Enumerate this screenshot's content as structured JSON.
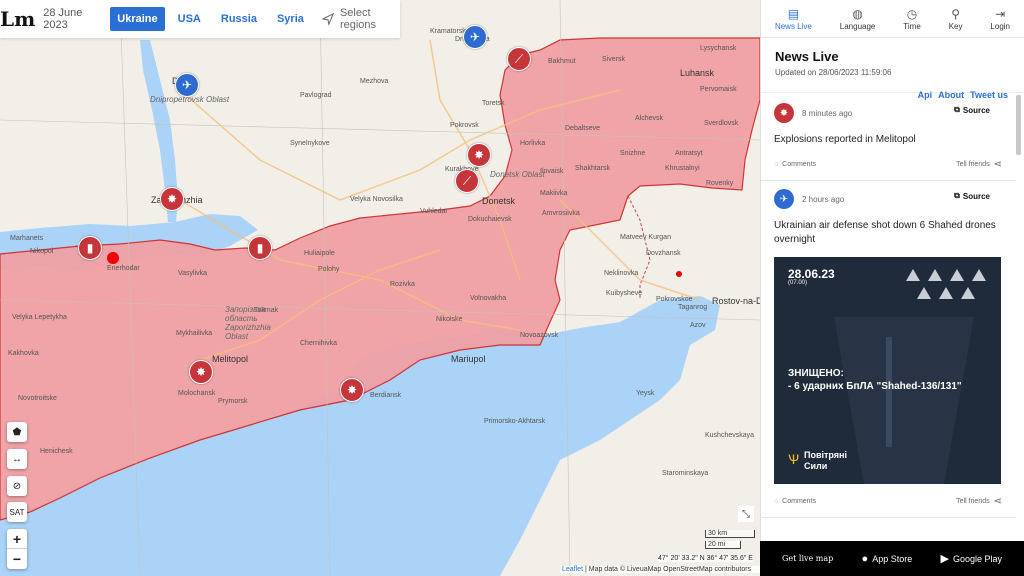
{
  "header": {
    "logo": "Lm",
    "date": "28 June 2023",
    "tabs": [
      {
        "label": "Ukraine",
        "active": true
      },
      {
        "label": "USA",
        "active": false
      },
      {
        "label": "Russia",
        "active": false
      },
      {
        "label": "Syria",
        "active": false
      }
    ],
    "select_regions": "Select regions"
  },
  "map": {
    "colors": {
      "occupied": "#f0a0a5",
      "occupied_border": "#d22b2b",
      "water": "#aad3f7",
      "land": "#f2efe9"
    },
    "places": [
      {
        "name": "Dnipro",
        "cls": "big"
      },
      {
        "name": "Zaporizhzhia",
        "cls": "big"
      },
      {
        "name": "Donetsk",
        "cls": "big"
      },
      {
        "name": "Luhansk",
        "cls": "big"
      },
      {
        "name": "Mariupol",
        "cls": "big"
      },
      {
        "name": "Berdiansk",
        "cls": ""
      },
      {
        "name": "Melitopol",
        "cls": "big"
      },
      {
        "name": "Enerhodar",
        "cls": ""
      },
      {
        "name": "Nikopol",
        "cls": ""
      },
      {
        "name": "Marhanets",
        "cls": ""
      },
      {
        "name": "Kramatorsk",
        "cls": ""
      },
      {
        "name": "Druzhkivka",
        "cls": ""
      },
      {
        "name": "Pokrovsk",
        "cls": ""
      },
      {
        "name": "Huliaipole",
        "cls": ""
      },
      {
        "name": "Tokmak",
        "cls": ""
      },
      {
        "name": "Polohy",
        "cls": ""
      },
      {
        "name": "Vasylivka",
        "cls": ""
      },
      {
        "name": "Kurakhove",
        "cls": ""
      },
      {
        "name": "Vuhledar",
        "cls": ""
      },
      {
        "name": "Velyka Novosilka",
        "cls": ""
      },
      {
        "name": "Makiivka",
        "cls": ""
      },
      {
        "name": "Horlivka",
        "cls": ""
      },
      {
        "name": "Debaltseve",
        "cls": ""
      },
      {
        "name": "Alchevsk",
        "cls": ""
      },
      {
        "name": "Khrustalnyi",
        "cls": ""
      },
      {
        "name": "Sverdlovsk",
        "cls": ""
      },
      {
        "name": "Novoazovsk",
        "cls": ""
      },
      {
        "name": "Taganrog",
        "cls": ""
      },
      {
        "name": "Rostov-na-Donu",
        "cls": "big"
      },
      {
        "name": "Azov",
        "cls": ""
      },
      {
        "name": "Yeysk",
        "cls": ""
      },
      {
        "name": "Primorsko-Akhtarsk",
        "cls": ""
      },
      {
        "name": "Kushchevskaya",
        "cls": ""
      },
      {
        "name": "Starominskaya",
        "cls": ""
      },
      {
        "name": "Pavlograd",
        "cls": ""
      },
      {
        "name": "Synelnykove",
        "cls": ""
      },
      {
        "name": "Mezhova",
        "cls": ""
      },
      {
        "name": "Velyka Lepetykha",
        "cls": ""
      },
      {
        "name": "Kakhovka",
        "cls": ""
      },
      {
        "name": "Novotroitske",
        "cls": ""
      },
      {
        "name": "Henichesk",
        "cls": ""
      },
      {
        "name": "Mykhailivka",
        "cls": ""
      },
      {
        "name": "Molochansk",
        "cls": ""
      },
      {
        "name": "Prymorsk",
        "cls": ""
      },
      {
        "name": "Chernihivka",
        "cls": ""
      },
      {
        "name": "Rozivka",
        "cls": ""
      },
      {
        "name": "Nikolske",
        "cls": ""
      },
      {
        "name": "Volnovakha",
        "cls": ""
      },
      {
        "name": "Dokuchaievsk",
        "cls": ""
      },
      {
        "name": "Amvrosiivka",
        "cls": ""
      },
      {
        "name": "Ilovaisk",
        "cls": ""
      },
      {
        "name": "Snizhne",
        "cls": ""
      },
      {
        "name": "Shakhtarsk",
        "cls": ""
      },
      {
        "name": "Toretsk",
        "cls": ""
      },
      {
        "name": "Bakhmut",
        "cls": ""
      },
      {
        "name": "Siversk",
        "cls": ""
      },
      {
        "name": "Lysychansk",
        "cls": ""
      },
      {
        "name": "Pervomaisk",
        "cls": ""
      },
      {
        "name": "Antratsyt",
        "cls": ""
      },
      {
        "name": "Rovenky",
        "cls": ""
      },
      {
        "name": "Dovzhansk",
        "cls": ""
      },
      {
        "name": "Kuibysheve",
        "cls": ""
      },
      {
        "name": "Matveev Kurgan",
        "cls": ""
      },
      {
        "name": "Pokrovskoe",
        "cls": ""
      },
      {
        "name": "Neklinovka",
        "cls": ""
      }
    ],
    "regions": [
      {
        "name": "Dnipropetrovsk Oblast"
      },
      {
        "name": "Запорізька область Zaporizhzhia Oblast"
      },
      {
        "name": "Donetsk Oblast"
      }
    ],
    "markers": [
      {
        "type": "blue",
        "icon": "✈",
        "name": "aircraft-marker"
      },
      {
        "type": "blue",
        "icon": "✈",
        "name": "aircraft-marker"
      },
      {
        "type": "red",
        "icon": "✸",
        "name": "explosion-marker"
      },
      {
        "type": "red",
        "icon": "▮",
        "name": "missile-marker"
      },
      {
        "type": "red",
        "icon": "▮",
        "name": "missile-marker"
      },
      {
        "type": "red",
        "icon": "✸",
        "name": "explosion-marker"
      },
      {
        "type": "red",
        "icon": "✸",
        "name": "explosion-marker"
      },
      {
        "type": "red",
        "icon": "✸",
        "name": "explosion-marker"
      },
      {
        "type": "red",
        "icon": "⟋",
        "name": "shelling-marker"
      },
      {
        "type": "red",
        "icon": "⟋",
        "name": "shelling-marker"
      },
      {
        "type": "red",
        "icon": "⟋",
        "name": "shelling-marker"
      }
    ],
    "controls": {
      "polygon": "⬟",
      "measure": "↔",
      "hide": "⊘",
      "sat": "SAT",
      "zoom_in": "+",
      "zoom_out": "−",
      "expand": "⤡"
    },
    "scale_km": "30 km",
    "scale_mi": "20 mi",
    "coords": "47° 20' 33.2\" N 36° 47' 35.6\" E",
    "attribution_leaflet": "Leaflet",
    "attribution_rest": " | Map data © LiveuaMap OpenStreetMap contributors"
  },
  "panel": {
    "nav": [
      {
        "label": "News Live",
        "icon": "▤",
        "active": true
      },
      {
        "label": "Language",
        "icon": "◍",
        "active": false
      },
      {
        "label": "Time",
        "icon": "◷",
        "active": false
      },
      {
        "label": "Key",
        "icon": "⚲",
        "active": false
      },
      {
        "label": "Login",
        "icon": "⇥",
        "active": false
      }
    ],
    "title": "News Live",
    "updated": "Updated on 28/06/2023 11:59:06",
    "links": [
      "Api",
      "About",
      "Tweet us"
    ],
    "items": [
      {
        "avatar": "✸",
        "avatar_type": "red",
        "time": "8 minutes ago",
        "source": "Source",
        "title": "Explosions reported in Melitopol",
        "comments": "Comments",
        "tell": "Tell friends"
      },
      {
        "avatar": "✈",
        "avatar_type": "blue",
        "time": "2 hours ago",
        "source": "Source",
        "title": "Ukrainian air defense shot down 6 Shahed drones overnight",
        "image": {
          "date": "28.06.23",
          "time": "(07.00)",
          "text1": "ЗНИЩЕНО:",
          "text2": "- 6 ударних БпЛА \"Shahed-136/131\"",
          "footer1": "Повітряні",
          "footer2": "Сили"
        },
        "comments": "Comments",
        "tell": "Tell friends"
      }
    ],
    "footer": {
      "get": "Get live map",
      "appstore": "App Store",
      "googleplay": "Google Play"
    }
  }
}
